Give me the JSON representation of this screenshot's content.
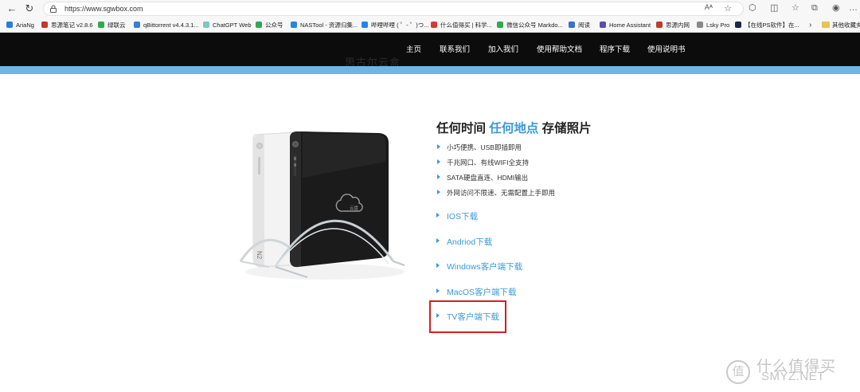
{
  "browser": {
    "url": "https://www.sgwbox.com",
    "read_aloud_label": "Aᴬ",
    "bookmarks": [
      {
        "label": "AriaNg",
        "color": "#2b7be4"
      },
      {
        "label": "思源笔记 v2.8.6",
        "color": "#c0392b"
      },
      {
        "label": "绿联云",
        "color": "#2eaa4f"
      },
      {
        "label": "qBittorrent v4.4.3.1...",
        "color": "#3b7dd8"
      },
      {
        "label": "ChatGPT Web",
        "color": "#7bc6c0"
      },
      {
        "label": "公众号",
        "color": "#2eaa4f"
      },
      {
        "label": "NASTool - 资源归集...",
        "color": "#1e88e5"
      },
      {
        "label": "哔哩哔哩 ( ゜- ゜)つ...",
        "color": "#1e88e5"
      },
      {
        "label": "什么值得买 | 科学...",
        "color": "#d63b2f"
      },
      {
        "label": "微信公众号 Markdo...",
        "color": "#2eaa4f"
      },
      {
        "label": "阅读",
        "color": "#3b6fd8"
      },
      {
        "label": "Home Assistant",
        "color": "#5a4fb0"
      },
      {
        "label": "思源内网",
        "color": "#c0392b"
      },
      {
        "label": "Lsky Pro",
        "color": "#888888"
      },
      {
        "label": "【在线PS软件】在...",
        "color": "#1a2a4a"
      }
    ],
    "more_label": "›",
    "other_favorites": "其他收藏夹"
  },
  "site": {
    "ghost_title": "思古尔云盒",
    "nav": [
      "主页",
      "联系我们",
      "加入我们",
      "使用帮助文档",
      "程序下载",
      "使用说明书"
    ]
  },
  "hero": {
    "headline_before": "任何时间 ",
    "headline_highlight": "任何地点",
    "headline_after": " 存储照片",
    "features": [
      "小巧便携、USB即插即用",
      "千兆网口、有线WIFI全支持",
      "SATA硬盘直连、HDMI输出",
      "外网访问不限速、无需配置上手即用"
    ],
    "downloads": [
      "IOS下载",
      "Andriod下载",
      "Windows客户端下载",
      "MacOS客户端下载",
      "TV客户端下载"
    ],
    "device_label": "N2",
    "device_logo_text": "云盘"
  },
  "watermark": {
    "logo": "值",
    "text": "什么值得买",
    "site": "SMYZ.NET"
  },
  "colors": {
    "accent": "#3a9ad9",
    "header_bg": "#0c0c0c",
    "stripe": "#6cb6e8",
    "highlight_border": "#d42020"
  }
}
